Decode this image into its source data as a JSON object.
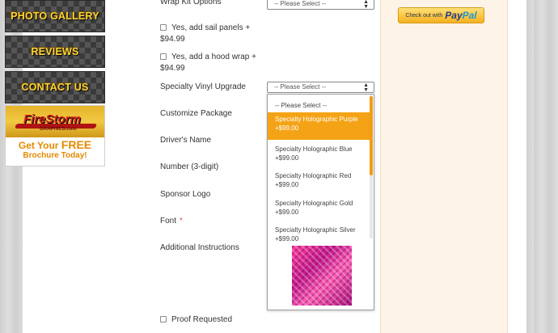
{
  "sidebar": {
    "buttons": [
      {
        "label": "PHOTO GALLERY"
      },
      {
        "label": "REVIEWS"
      },
      {
        "label": "CONTACT US"
      }
    ],
    "brochure": {
      "logo_alt": "FireStorm Graphics",
      "line1_prefix": "Get Your ",
      "line1_free": "FREE",
      "line2": "Brochure Today!"
    }
  },
  "form": {
    "wrap_kit": {
      "label": "Wrap Kit Options",
      "value": "-- Please Select --"
    },
    "sail_panels": {
      "label": "Yes, add sail panels +",
      "price": "$94.99",
      "checked": false
    },
    "hood_wrap": {
      "label": "Yes, add a hood wrap +",
      "price": "$94.99",
      "checked": false
    },
    "vinyl": {
      "label": "Specialty Vinyl Upgrade",
      "value": "-- Please Select --",
      "options": [
        {
          "name": "-- Please Select --",
          "price": ""
        },
        {
          "name": "Specialty Holographic Purple",
          "price": "+$99.00"
        },
        {
          "name": "Specialty Holographic Blue",
          "price": "+$99.00"
        },
        {
          "name": "Specialty Holographic Red",
          "price": "+$99.00"
        },
        {
          "name": "Specialty Holographic Gold",
          "price": "+$99.00"
        },
        {
          "name": "Specialty Holographic Silver",
          "price": "+$99.00"
        }
      ],
      "selected_index": 1,
      "preview_color": "#d81b8c"
    },
    "fields": [
      {
        "label": "Customize Package"
      },
      {
        "label": "Driver's Name"
      },
      {
        "label": "Number (3-digit)"
      },
      {
        "label": "Sponsor Logo"
      },
      {
        "label": "Font",
        "required_mark": "*"
      },
      {
        "label": "Additional Instructions"
      }
    ],
    "proof": {
      "label": "Proof Requested",
      "checked": false
    }
  },
  "paypal": {
    "prefix": "Check out with",
    "brand_a": "Pay",
    "brand_b": "Pal"
  },
  "colors": {
    "accent": "#f4a316",
    "sidebar_text": "#ffd43a",
    "right_bg": "#fdf3e6"
  }
}
